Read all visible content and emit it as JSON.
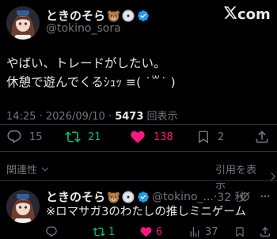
{
  "brand": "com",
  "main_tweet": {
    "display_name": "ときのそら",
    "handle": "@tokino_sora",
    "text_line1": "やばい、トレードがしたい。",
    "text_line2": "休憩で遊んでくるｼｭｯ ≡( ˙꒳˙ )",
    "time": "14:25",
    "date": "2026/09/10",
    "views": "5473",
    "views_label": "回表示",
    "replies": "15",
    "retweets": "21",
    "likes": "138",
    "bookmarks": "2"
  },
  "bar": {
    "related": "関連性",
    "show_quotes": "引用を表示"
  },
  "reply_tweet": {
    "display_name": "ときのそら",
    "handle": "@tokino_...",
    "time_ago": "32 秒",
    "text": "※ロマサガ3のわたしの推しミニゲーム",
    "replies": "",
    "retweets": "1",
    "likes": "6",
    "views": "37"
  },
  "colors": {
    "retweet_active": "#00ba7c",
    "like_active": "#f91880",
    "verified": "#1d9bf0",
    "muted": "#71767b",
    "text": "#e7e9ea"
  }
}
